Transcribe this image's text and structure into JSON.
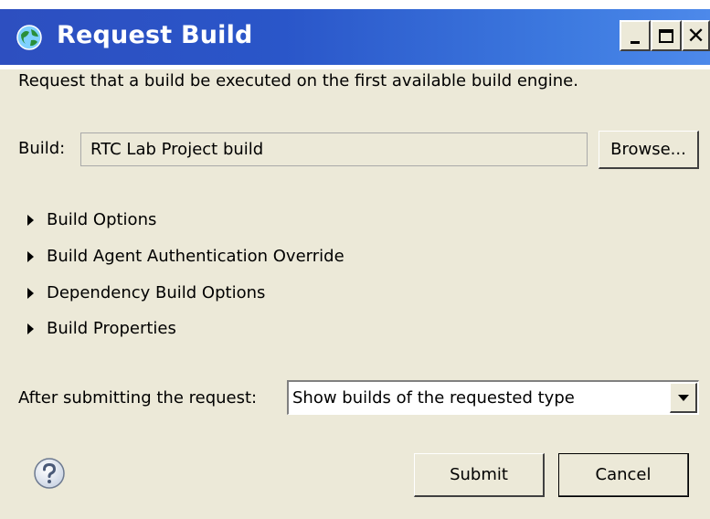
{
  "window": {
    "title": "Request Build",
    "colors": {
      "titlebar": "#2a56c9",
      "background": "#ece9d8"
    }
  },
  "description": "Request that a build be executed on the first available build engine.",
  "build": {
    "label": "Build:",
    "value": "RTC Lab Project build",
    "browse_label": "Browse..."
  },
  "sections": [
    {
      "label": "Build Options",
      "expanded": false
    },
    {
      "label": "Build Agent Authentication Override",
      "expanded": false
    },
    {
      "label": "Dependency Build Options",
      "expanded": false
    },
    {
      "label": "Build Properties",
      "expanded": false
    }
  ],
  "after_submit": {
    "label": "After submitting the request:",
    "selected": "Show builds of the requested type"
  },
  "buttons": {
    "submit": "Submit",
    "cancel": "Cancel"
  },
  "icons": {
    "app": "globe-icon",
    "help": "help-icon"
  }
}
